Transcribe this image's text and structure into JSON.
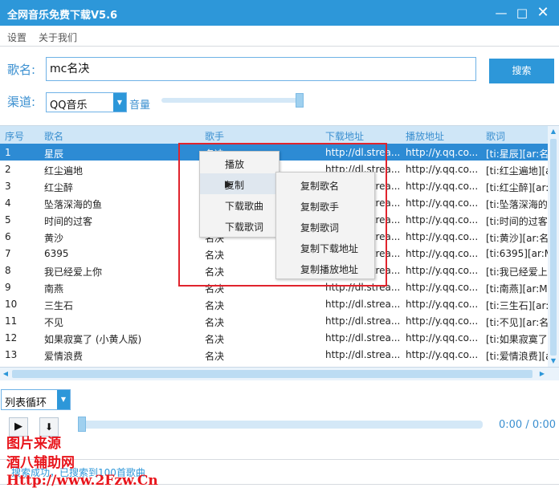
{
  "window": {
    "title": "全网音乐免费下载V5.6",
    "min_glyph": "—",
    "max_glyph": "□",
    "close_glyph": "✕"
  },
  "menu": [
    "设置",
    "关于我们"
  ],
  "search": {
    "label": "歌名:",
    "value": "mc名决",
    "button": "搜索"
  },
  "channel": {
    "label": "渠道:",
    "value": "QQ音乐",
    "volume_label": "音量",
    "volume_level": 0.98
  },
  "table": {
    "headers": [
      "序号",
      "歌名",
      "歌手",
      "下载地址",
      "播放地址",
      "歌词"
    ],
    "rows": [
      {
        "no": "1",
        "name": "星辰",
        "artist": "名决",
        "download": "http://dl.strea...",
        "play": "http://y.qq.co...",
        "lyrics": "[ti:星辰][ar:名..."
      },
      {
        "no": "2",
        "name": "红尘遍地",
        "artist": "",
        "download": "http://dl.strea...",
        "play": "http://y.qq.co...",
        "lyrics": "[ti:红尘遍地][a..."
      },
      {
        "no": "3",
        "name": "红尘醉",
        "artist": "",
        "download": "http://dl.strea...",
        "play": "http://y.qq.co...",
        "lyrics": "[ti:红尘醉][ar:..."
      },
      {
        "no": "4",
        "name": "坠落深海的鱼",
        "artist": "",
        "download": "http://dl.strea...",
        "play": "http://y.qq.co...",
        "lyrics": "[ti:坠落深海的..."
      },
      {
        "no": "5",
        "name": "时间的过客",
        "artist": "",
        "download": "http://dl.strea...",
        "play": "http://y.qq.co...",
        "lyrics": "[ti:时间的过客..."
      },
      {
        "no": "6",
        "name": "黄沙",
        "artist": "名决",
        "download": "http://dl.strea...",
        "play": "http://y.qq.co...",
        "lyrics": "[ti:黄沙][ar:名..."
      },
      {
        "no": "7",
        "name": "6395",
        "artist": "名决",
        "download": "http://dl.strea...",
        "play": "http://y.qq.co...",
        "lyrics": "[ti:6395][ar:M..."
      },
      {
        "no": "8",
        "name": "我已经爱上你",
        "artist": "名决",
        "download": "http://dl.strea...",
        "play": "http://y.qq.co...",
        "lyrics": "[ti:我已经爱上..."
      },
      {
        "no": "9",
        "name": "南燕",
        "artist": "名决",
        "download": "http://dl.strea...",
        "play": "http://y.qq.co...",
        "lyrics": "[ti:南燕][ar:M..."
      },
      {
        "no": "10",
        "name": "三生石",
        "artist": "名决",
        "download": "http://dl.strea...",
        "play": "http://y.qq.co...",
        "lyrics": "[ti:三生石][ar:..."
      },
      {
        "no": "11",
        "name": "不见",
        "artist": "名决",
        "download": "http://dl.strea...",
        "play": "http://y.qq.co...",
        "lyrics": "[ti:不见][ar:名..."
      },
      {
        "no": "12",
        "name": "如果寂寞了 (小黄人版)",
        "artist": "名决",
        "download": "http://dl.strea...",
        "play": "http://y.qq.co...",
        "lyrics": "[ti:如果寂寞了..."
      },
      {
        "no": "13",
        "name": "爱情浪费",
        "artist": "名决",
        "download": "http://dl.strea...",
        "play": "http://y.qq.co...",
        "lyrics": "[ti:爱情浪费][a..."
      }
    ]
  },
  "context_menu": {
    "items": [
      "播放",
      "复制",
      "下载歌曲",
      "下载歌词"
    ],
    "copy_submenu": [
      "复制歌名",
      "复制歌手",
      "复制歌词",
      "复制下载地址",
      "复制播放地址"
    ]
  },
  "player": {
    "mode": "列表循环",
    "play_glyph": "▶",
    "download_glyph": "⬇",
    "time": "0:00 / 0:00",
    "progress": 0.0
  },
  "status": "搜索成功，已搜索到100首歌曲",
  "watermark": [
    "图片来源",
    "酒八辅助网",
    "Http://www.2Fzw.Cn"
  ],
  "colors": {
    "accent": "#2d97d9",
    "selected_row": "#2d8bd4",
    "header_bg": "#cfe6f7",
    "highlight_box": "#e0242d"
  }
}
